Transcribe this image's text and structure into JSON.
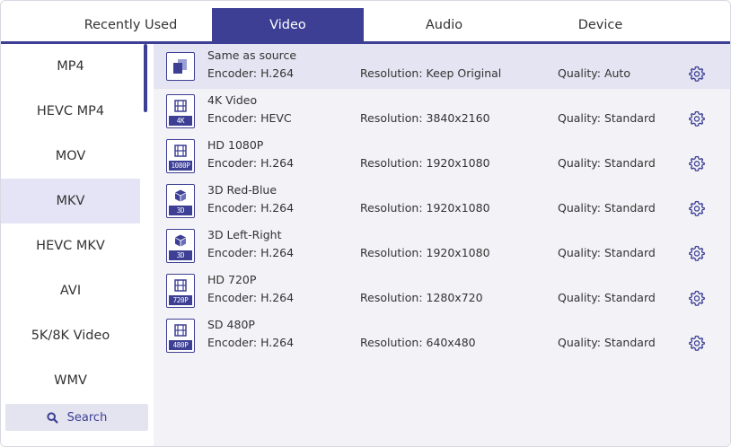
{
  "tabs": [
    {
      "label": "Recently Used",
      "active": false
    },
    {
      "label": "Video",
      "active": true
    },
    {
      "label": "Audio",
      "active": false
    },
    {
      "label": "Device",
      "active": false
    }
  ],
  "sidebar": {
    "items": [
      {
        "label": "MP4",
        "active": false
      },
      {
        "label": "HEVC MP4",
        "active": false
      },
      {
        "label": "MOV",
        "active": false
      },
      {
        "label": "MKV",
        "active": true
      },
      {
        "label": "HEVC MKV",
        "active": false
      },
      {
        "label": "AVI",
        "active": false
      },
      {
        "label": "5K/8K Video",
        "active": false
      },
      {
        "label": "WMV",
        "active": false
      }
    ],
    "search_label": "Search"
  },
  "presets": [
    {
      "name": "Same as source",
      "encoder": "Encoder: H.264",
      "resolution": "Resolution: Keep Original",
      "quality": "Quality: Auto",
      "icon": "copy-icon",
      "tag": "",
      "active": true
    },
    {
      "name": "4K Video",
      "encoder": "Encoder: HEVC",
      "resolution": "Resolution: 3840x2160",
      "quality": "Quality: Standard",
      "icon": "film-icon",
      "tag": "4K",
      "active": false
    },
    {
      "name": "HD 1080P",
      "encoder": "Encoder: H.264",
      "resolution": "Resolution: 1920x1080",
      "quality": "Quality: Standard",
      "icon": "film-icon",
      "tag": "1080P",
      "active": false
    },
    {
      "name": "3D Red-Blue",
      "encoder": "Encoder: H.264",
      "resolution": "Resolution: 1920x1080",
      "quality": "Quality: Standard",
      "icon": "cube-icon",
      "tag": "3D",
      "active": false
    },
    {
      "name": "3D Left-Right",
      "encoder": "Encoder: H.264",
      "resolution": "Resolution: 1920x1080",
      "quality": "Quality: Standard",
      "icon": "cube-icon",
      "tag": "3D",
      "active": false
    },
    {
      "name": "HD 720P",
      "encoder": "Encoder: H.264",
      "resolution": "Resolution: 1280x720",
      "quality": "Quality: Standard",
      "icon": "film-icon",
      "tag": "720P",
      "active": false
    },
    {
      "name": "SD 480P",
      "encoder": "Encoder: H.264",
      "resolution": "Resolution: 640x480",
      "quality": "Quality: Standard",
      "icon": "film-icon",
      "tag": "480P",
      "active": false
    }
  ],
  "colors": {
    "accent": "#3d3f94",
    "active_bg": "#e4e4f6",
    "list_bg": "#f3f3f7"
  }
}
